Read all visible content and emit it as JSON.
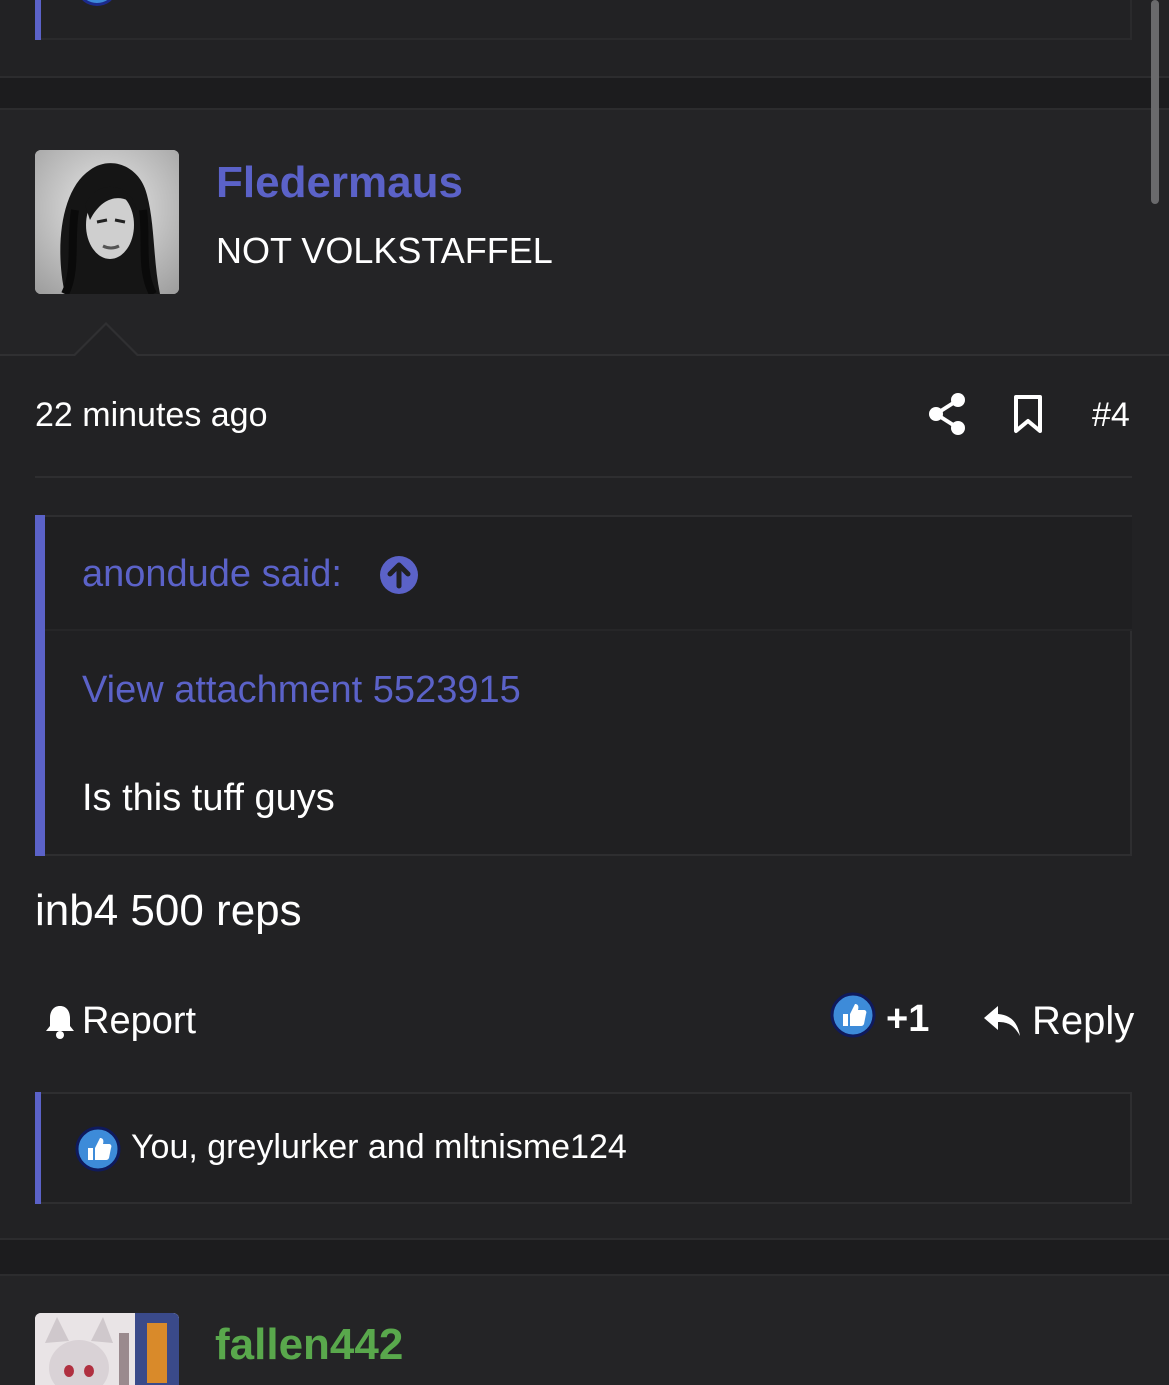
{
  "post": {
    "author": "Fledermaus",
    "user_title": "NOT VOLKSTAFFEL",
    "time": "22 minutes ago",
    "post_number": "#4",
    "quote": {
      "author_label": "anondude said:",
      "attachment_link": "View attachment 5523915",
      "text": "Is this tuff guys"
    },
    "body": "inb4 500 reps",
    "actions": {
      "report_label": "Report",
      "like_count": "+1",
      "reply_label": "Reply"
    },
    "reactions_text": "You, greylurker and mltnisme124"
  },
  "next_post": {
    "author": "fallen442"
  },
  "icons": {
    "share": "share-icon",
    "bookmark": "bookmark-icon",
    "quote_jump": "arrow-up-circle-icon",
    "report": "bell-icon",
    "like": "thumbs-up-icon",
    "reply": "reply-arrow-icon"
  },
  "colors": {
    "accent": "#5b62c8",
    "next_author": "#59a84c",
    "background": "#1c1c1e",
    "post_background": "#222224"
  }
}
